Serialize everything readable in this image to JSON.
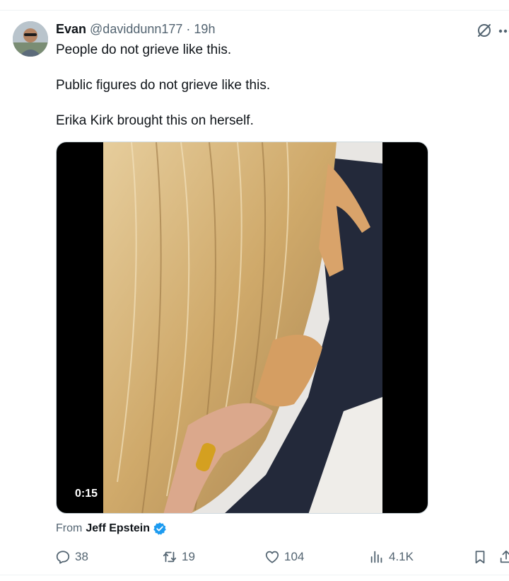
{
  "tweet": {
    "author_name": "Evan",
    "handle": "@daviddunn177",
    "separator": "·",
    "time": "19h",
    "lines": [
      "People do not grieve like this.",
      "Public figures do not grieve like this.",
      "Erika Kirk brought this on herself."
    ]
  },
  "media": {
    "duration": "0:15"
  },
  "source": {
    "label": "From",
    "name": "Jeff Epstein",
    "verified": true
  },
  "actions": {
    "replies": "38",
    "reposts": "19",
    "likes": "104",
    "views": "4.1K"
  },
  "icons": {
    "top_right": [
      "grok-icon",
      "more-icon"
    ],
    "actions": [
      "reply-icon",
      "repost-icon",
      "like-icon",
      "views-icon",
      "bookmark-icon",
      "share-icon"
    ]
  },
  "colors": {
    "text": "#0f1419",
    "secondary": "#536471",
    "verified": "#1d9bf0",
    "divider": "#eff3f4"
  }
}
